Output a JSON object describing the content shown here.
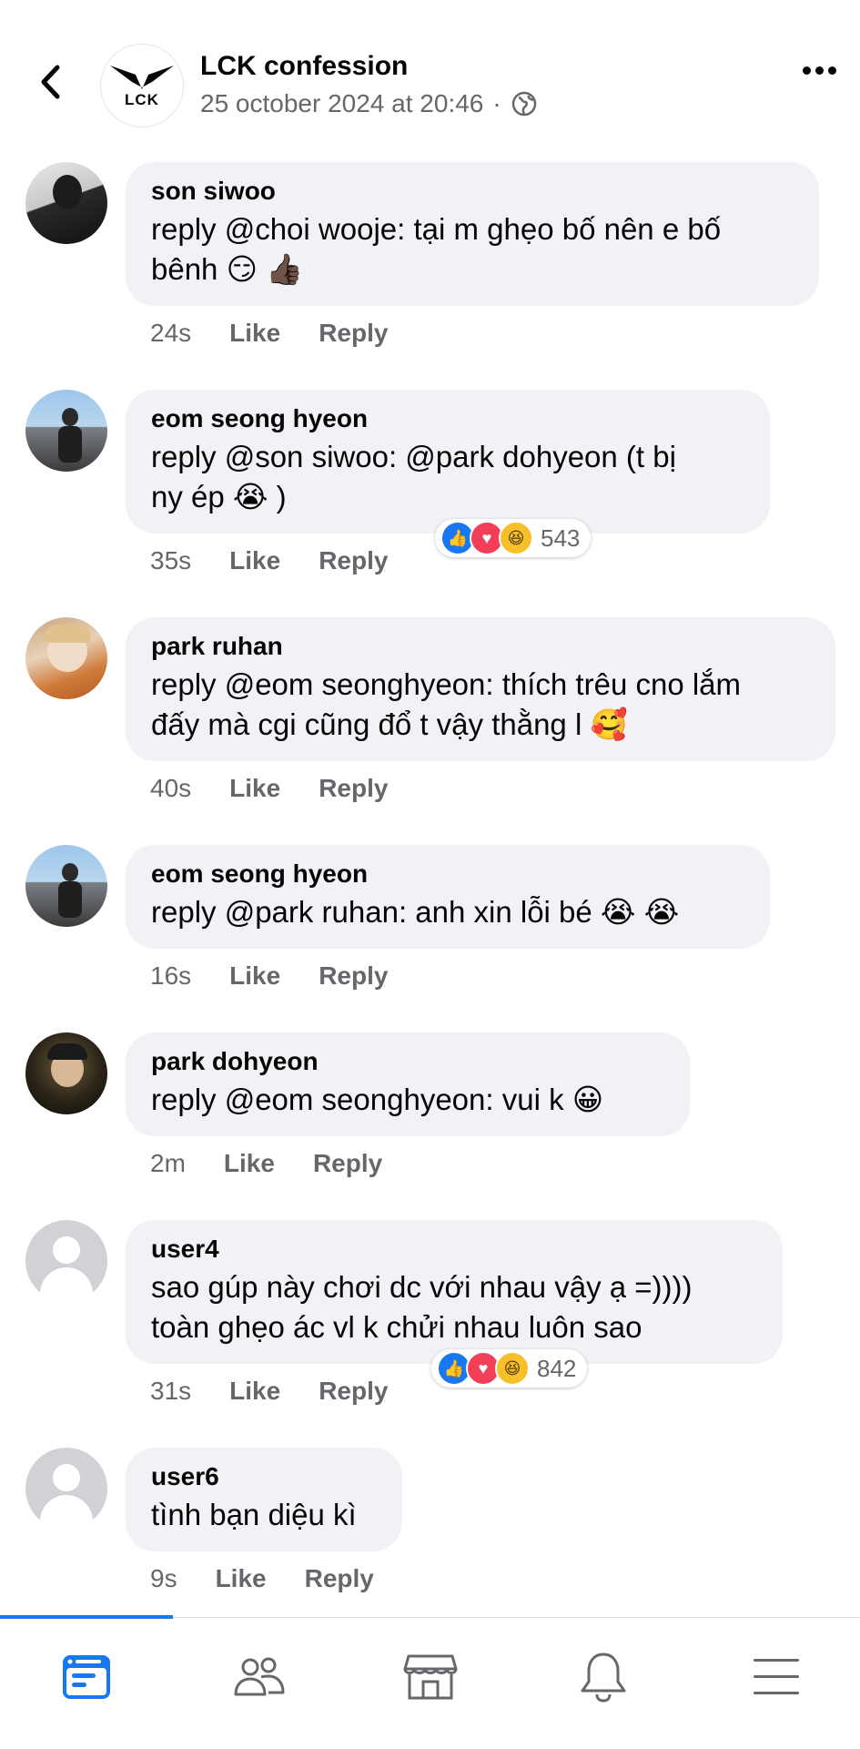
{
  "header": {
    "page_name": "LCK confession",
    "timestamp": "25 october 2024 at 20:46",
    "separator": "·",
    "logo_text": "LCK"
  },
  "comments": [
    {
      "author": "son siwoo",
      "text": "reply @choi wooje: tại m ghẹo bố nên e bố",
      "text2": "bênh 😏 👍🏿",
      "time": "24s",
      "like": "Like",
      "reply": "Reply"
    },
    {
      "author": "eom seong hyeon",
      "text": "reply @son siwoo: @park dohyeon (t bị",
      "text2": "ny ép 😭 )",
      "time": "35s",
      "like": "Like",
      "reply": "Reply",
      "reaction_count": "543"
    },
    {
      "author": "park ruhan",
      "text": "reply @eom seonghyeon: thích trêu cno lắm",
      "text2": "đấy mà cgi cũng đổ t vậy thằng l 🥰",
      "time": "40s",
      "like": "Like",
      "reply": "Reply"
    },
    {
      "author": "eom seong hyeon",
      "text": "reply @park ruhan: anh xin lỗi bé 😭 😭",
      "time": "16s",
      "like": "Like",
      "reply": "Reply"
    },
    {
      "author": "park dohyeon",
      "text": "reply @eom seonghyeon: vui k 😀",
      "time": "2m",
      "like": "Like",
      "reply": "Reply"
    },
    {
      "author": "user4",
      "text": "sao gúp này chơi dc với nhau vậy ạ =))))",
      "text2": "toàn ghẹo ác vl k chửi nhau luôn sao",
      "time": "31s",
      "like": "Like",
      "reply": "Reply",
      "reaction_count": "842"
    },
    {
      "author": "user6",
      "text": "tình bạn diệu kì",
      "time": "9s",
      "like": "Like",
      "reply": "Reply"
    }
  ],
  "colors": {
    "accent": "#1877f2",
    "bubble": "#f0f2f5",
    "secondary_text": "#65676b"
  },
  "icons": {
    "back": "chevron-left-icon",
    "more": "more-dots-icon",
    "globe": "globe-icon",
    "nav": [
      "feed-icon",
      "friends-icon",
      "marketplace-icon",
      "bell-icon",
      "menu-icon"
    ]
  }
}
